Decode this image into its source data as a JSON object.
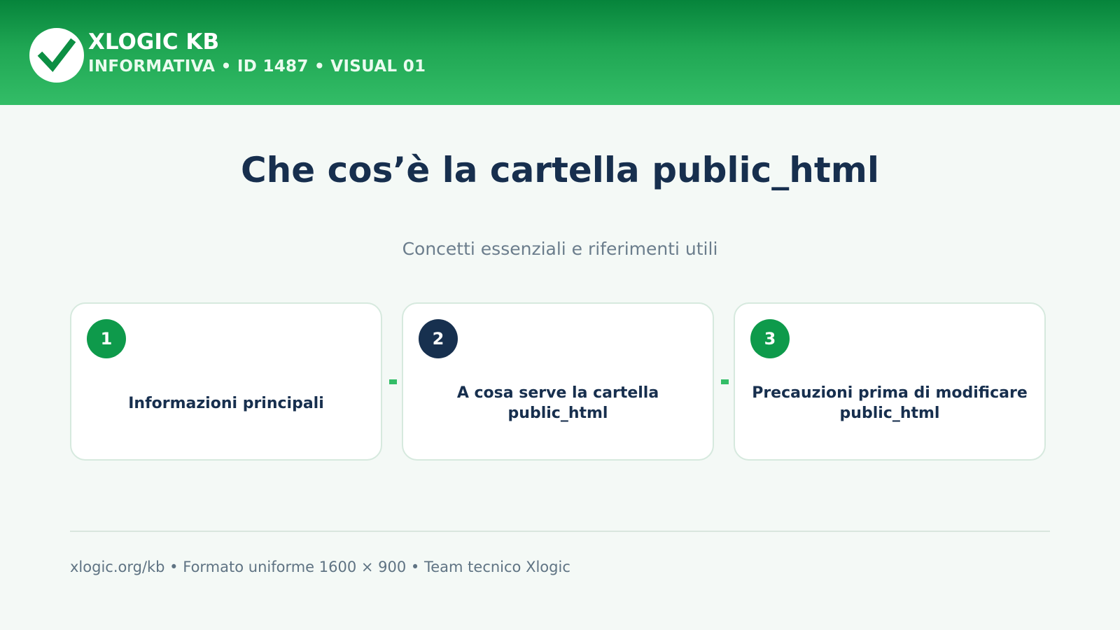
{
  "header": {
    "logo_icon": "check-icon",
    "title": "XLOGIC KB",
    "subtitle": "INFORMATIVA • ID 1487 • VISUAL 01"
  },
  "main": {
    "title": "Che cos’è la cartella public_html",
    "subtitle": "Concetti essenziali e riferimenti utili",
    "steps": [
      {
        "number": "1",
        "text": "Informazioni principali",
        "badge_color": "#0e9a4b"
      },
      {
        "number": "2",
        "text": "A cosa serve la cartella public_html",
        "badge_color": "#17304f"
      },
      {
        "number": "3",
        "text": "Precauzioni prima di modificare public_html",
        "badge_color": "#0e9a4b"
      }
    ]
  },
  "footer": {
    "text": "xlogic.org/kb • Formato uniforme 1600 × 900 • Team tecnico Xlogic"
  },
  "colors": {
    "brand_green": "#1fa653",
    "navy": "#172f4e",
    "accent": "#33bd67"
  }
}
